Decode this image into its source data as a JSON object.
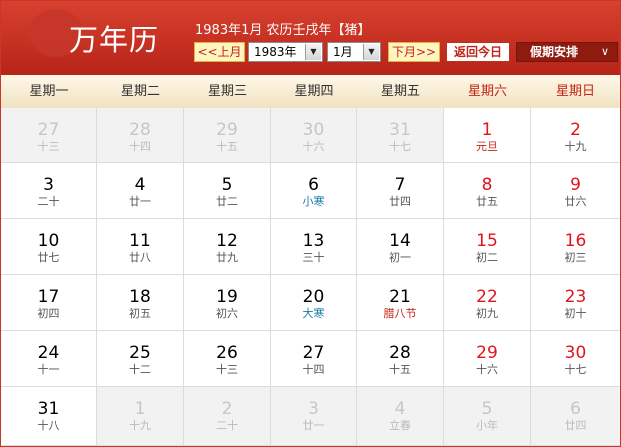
{
  "header": {
    "logo": "万年历",
    "subtitle": "1983年1月 农历壬戌年【猪】",
    "prev_button": "<<上月",
    "next_button": "下月>>",
    "year_select": "1983年",
    "month_select": "1月",
    "today_button": "返回今日",
    "holiday_button": "假期安排"
  },
  "weekdays": [
    "星期一",
    "星期二",
    "星期三",
    "星期四",
    "星期五",
    "星期六",
    "星期日"
  ],
  "weeks": [
    [
      {
        "day": "27",
        "lunar": "十三",
        "other": true
      },
      {
        "day": "28",
        "lunar": "十四",
        "other": true
      },
      {
        "day": "29",
        "lunar": "十五",
        "other": true
      },
      {
        "day": "30",
        "lunar": "十六",
        "other": true
      },
      {
        "day": "31",
        "lunar": "十七",
        "other": true
      },
      {
        "day": "1",
        "lunar": "元旦",
        "other": false,
        "kind": "fest"
      },
      {
        "day": "2",
        "lunar": "十九",
        "other": false
      }
    ],
    [
      {
        "day": "3",
        "lunar": "二十",
        "other": false
      },
      {
        "day": "4",
        "lunar": "廿一",
        "other": false
      },
      {
        "day": "5",
        "lunar": "廿二",
        "other": false
      },
      {
        "day": "6",
        "lunar": "小寒",
        "other": false,
        "kind": "term"
      },
      {
        "day": "7",
        "lunar": "廿四",
        "other": false
      },
      {
        "day": "8",
        "lunar": "廿五",
        "other": false
      },
      {
        "day": "9",
        "lunar": "廿六",
        "other": false
      }
    ],
    [
      {
        "day": "10",
        "lunar": "廿七",
        "other": false
      },
      {
        "day": "11",
        "lunar": "廿八",
        "other": false
      },
      {
        "day": "12",
        "lunar": "廿九",
        "other": false
      },
      {
        "day": "13",
        "lunar": "三十",
        "other": false
      },
      {
        "day": "14",
        "lunar": "初一",
        "other": false
      },
      {
        "day": "15",
        "lunar": "初二",
        "other": false
      },
      {
        "day": "16",
        "lunar": "初三",
        "other": false
      }
    ],
    [
      {
        "day": "17",
        "lunar": "初四",
        "other": false
      },
      {
        "day": "18",
        "lunar": "初五",
        "other": false
      },
      {
        "day": "19",
        "lunar": "初六",
        "other": false
      },
      {
        "day": "20",
        "lunar": "大寒",
        "other": false,
        "kind": "term"
      },
      {
        "day": "21",
        "lunar": "腊八节",
        "other": false,
        "kind": "fest"
      },
      {
        "day": "22",
        "lunar": "初九",
        "other": false
      },
      {
        "day": "23",
        "lunar": "初十",
        "other": false
      }
    ],
    [
      {
        "day": "24",
        "lunar": "十一",
        "other": false
      },
      {
        "day": "25",
        "lunar": "十二",
        "other": false
      },
      {
        "day": "26",
        "lunar": "十三",
        "other": false
      },
      {
        "day": "27",
        "lunar": "十四",
        "other": false
      },
      {
        "day": "28",
        "lunar": "十五",
        "other": false
      },
      {
        "day": "29",
        "lunar": "十六",
        "other": false
      },
      {
        "day": "30",
        "lunar": "十七",
        "other": false
      }
    ],
    [
      {
        "day": "31",
        "lunar": "十八",
        "other": false
      },
      {
        "day": "1",
        "lunar": "十九",
        "other": true
      },
      {
        "day": "2",
        "lunar": "二十",
        "other": true
      },
      {
        "day": "3",
        "lunar": "廿一",
        "other": true
      },
      {
        "day": "4",
        "lunar": "立春",
        "other": true,
        "kind": "term"
      },
      {
        "day": "5",
        "lunar": "小年",
        "other": true,
        "kind": "fest"
      },
      {
        "day": "6",
        "lunar": "廿四",
        "other": true
      }
    ]
  ],
  "colors": {
    "header_red": "#c8321f",
    "weekend_red": "#e0141e",
    "solar_term_blue": "#1b7aa6",
    "festival_red": "#c32415"
  }
}
